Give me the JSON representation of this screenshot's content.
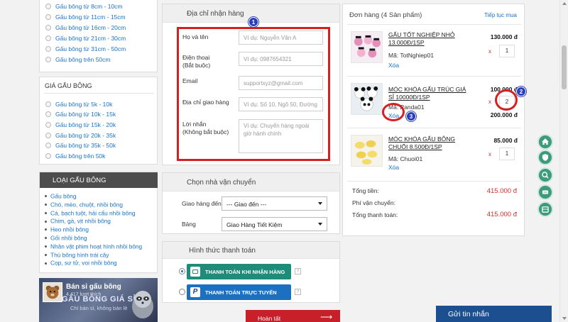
{
  "price_filter_top": {
    "items": [
      "Gấu bông từ 8cm - 10cm",
      "Gấu bông từ 11cm - 15cm",
      "Gấu bông từ 16cm - 20cm",
      "Gấu bông từ 21cm - 30cm",
      "Gấu bông từ 31cm - 50cm",
      "Gấu bông trên 50cm"
    ]
  },
  "price_filter": {
    "title": "GIÁ GẤU BÔNG",
    "items": [
      "Gấu bông từ 5k - 10k",
      "Gấu bông từ 10k - 15k",
      "Gấu bông từ 15k - 20k",
      "Gấu bông từ 20k - 35k",
      "Gấu bông từ 35k - 50k",
      "Gấu bông trên 50k"
    ]
  },
  "categories": {
    "title": "LOẠI GẤU BÔNG",
    "items": [
      "Gấu bông",
      "Chó, mèo, chuột, nhồi bông",
      "Cá, bạch tuột, hải cẩu nhồi bông",
      "Chim, gà, vịt nhồi bông",
      "Heo nhồi bông",
      "Gối nhồi bông",
      "Nhân vật phim hoạt hình nhồi bông",
      "Thú bông hình trái cây",
      "Cọp, sư tử, voi nhồi bông"
    ]
  },
  "fb_widget": {
    "page_name": "Bán sỉ gấu bông",
    "likes": "4.417 lượt thích",
    "banner_text": "GẤU BÔNG GIÁ SỈ",
    "banner_sub": "Chỉ bán sỉ, không bán lẻ"
  },
  "address_form": {
    "title": "Địa chỉ nhận hàng",
    "badge": "1",
    "fields": {
      "name": {
        "label": "Họ và tên",
        "placeholder": "Ví dụ: Nguyễn Văn A"
      },
      "phone": {
        "label": "Điện thoại",
        "sublabel": "(Bắt buộc)",
        "placeholder": "Ví dụ: 0987654321"
      },
      "email": {
        "label": "Email",
        "placeholder": "supportxyz@gmail.com"
      },
      "address": {
        "label": "Địa chỉ giao hàng",
        "placeholder": "Ví dụ: Số 10, Ngõ 50, Đường A"
      },
      "message": {
        "label": "Lời nhắn",
        "sublabel": "(Không bắt buộc)",
        "placeholder": "Ví dụ: Chuyển hàng ngoài giờ hành chính"
      }
    }
  },
  "shipping": {
    "title": "Chọn nhà vận chuyển",
    "deliver_to_label": "Giao hàng đến",
    "deliver_to_value": "--- Giao đến ---",
    "table_label": "Bảng",
    "table_value": "Giao Hàng Tiết Kiệm"
  },
  "payment": {
    "title": "Hình thức thanh toán",
    "cod_label": "THANH TOÁN KHI NHẬN HÀNG",
    "online_label": "THANH TOÁN TRỰC TUYẾN",
    "help": "?"
  },
  "submit_label": "Hoàn tất",
  "order": {
    "title": "Đơn hàng (4 Sản phẩm)",
    "continue_label": "Tiếp tục mua",
    "items": [
      {
        "name_line1": "GẤU TỐT NGHIỆP NHỎ",
        "name_line2": "13.000Đ/1SP",
        "price": "130.000 đ",
        "qty": "1",
        "code": "Mã: TotNghiep01",
        "delete": "Xóa",
        "total": ""
      },
      {
        "name_line1": "MÓC KHÓA GẤU TRÚC GIÁ",
        "name_line2": "SỈ 10000Đ/1SP",
        "price": "100.000 đ",
        "qty": "2",
        "code": "Mã: Panda01",
        "delete": "Xóa",
        "total": "200.000 đ"
      },
      {
        "name_line1": "MÓC KHÓA GẤU BÔNG",
        "name_line2": "CHUỐI 8.500Đ/1SP",
        "price": "85.000 đ",
        "qty": "1",
        "code": "Mã: Chuoi01",
        "delete": "Xóa",
        "total": ""
      }
    ],
    "x": "x",
    "subtotal_label": "Tổng tiền:",
    "subtotal_value": "415.000 đ",
    "shipping_fee_label": "Phí vận chuyển:",
    "total_label": "Tổng thanh toán:",
    "total_value": "415.000 đ",
    "badge_qty": "2",
    "badge_delete": "3"
  },
  "chat_button": "Gửi tin nhắn",
  "side_icons": [
    "home-icon",
    "shield-icon",
    "search-icon",
    "tag-icon",
    "gift-icon"
  ],
  "colors": {
    "link": "#1a73c9",
    "price_red": "#d32d2d",
    "submit": "#c8202a",
    "payment_teal": "#1f8c7a",
    "payment_blue": "#1c70c2",
    "chat": "#1c4f8f",
    "highlight": "#d42020"
  }
}
